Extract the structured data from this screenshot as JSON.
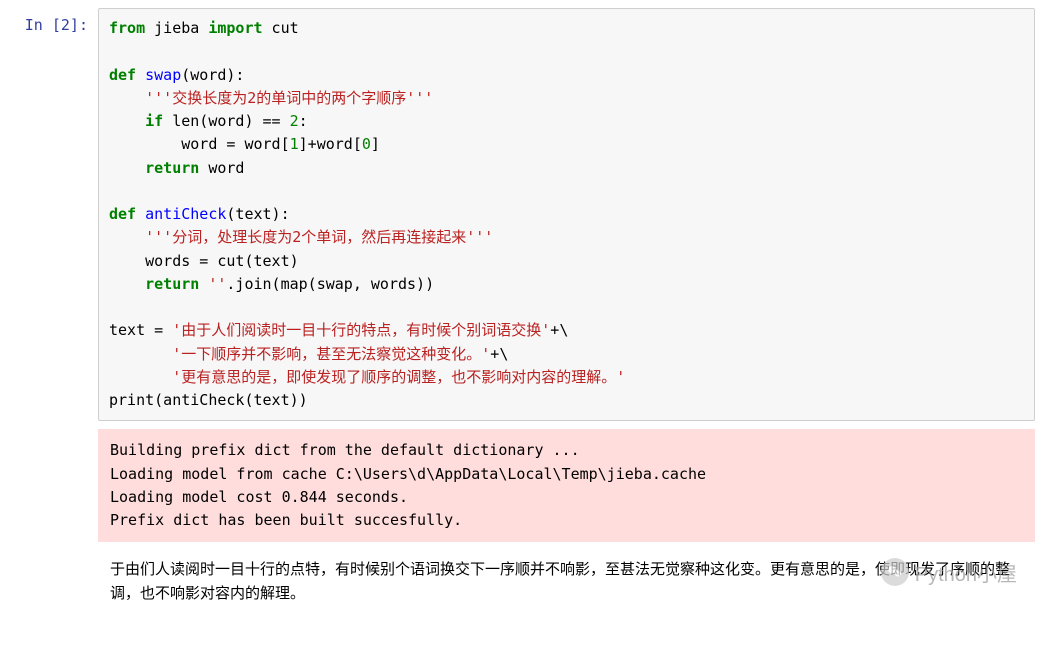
{
  "prompt": "In  [2]:",
  "code": {
    "line01": {
      "p1": "from",
      "p2": " jieba ",
      "p3": "import",
      "p4": " cut"
    },
    "line03": {
      "p1": "def",
      "p2": " ",
      "p3": "swap",
      "p4": "(word):"
    },
    "line04": {
      "p1": "    ",
      "p2": "'''交换长度为2的单词中的两个字顺序'''"
    },
    "line05": {
      "p1": "    ",
      "p2": "if",
      "p3": " len(word) == ",
      "p4": "2",
      "p5": ":"
    },
    "line06": {
      "p1": "        word = word[",
      "p2": "1",
      "p3": "]+word[",
      "p4": "0",
      "p5": "]"
    },
    "line07": {
      "p1": "    ",
      "p2": "return",
      "p3": " word"
    },
    "line09": {
      "p1": "def",
      "p2": " ",
      "p3": "antiCheck",
      "p4": "(text):"
    },
    "line10": {
      "p1": "    ",
      "p2": "'''分词，处理长度为2个单词，然后再连接起来'''"
    },
    "line11": {
      "p1": "    words = cut(text)"
    },
    "line12": {
      "p1": "    ",
      "p2": "return",
      "p3": " ",
      "p4": "''",
      "p5": ".join(map(swap, words))"
    },
    "line14": {
      "p1": "text = ",
      "p2": "'由于人们阅读时一目十行的特点，有时候个别词语交换'",
      "p3": "+\\"
    },
    "line15": {
      "p1": "       ",
      "p2": "'一下顺序并不影响，甚至无法察觉这种变化。'",
      "p3": "+\\"
    },
    "line16": {
      "p1": "       ",
      "p2": "'更有意思的是，即使发现了顺序的调整，也不影响对内容的理解。'"
    },
    "line17": {
      "p1": "print(antiCheck(text))"
    }
  },
  "stderr": "Building prefix dict from the default dictionary ...\nLoading model from cache C:\\Users\\d\\AppData\\Local\\Temp\\jieba.cache\nLoading model cost 0.844 seconds.\nPrefix dict has been built succesfully.",
  "stdout": "于由们人读阅时一目十行的点特，有时候别个语词换交下一序顺并不响影，至甚法无觉察种这化变。更有意思的是，使即现发了序顺的整调，也不响影对容内的解理。",
  "watermark": "Python小屋"
}
